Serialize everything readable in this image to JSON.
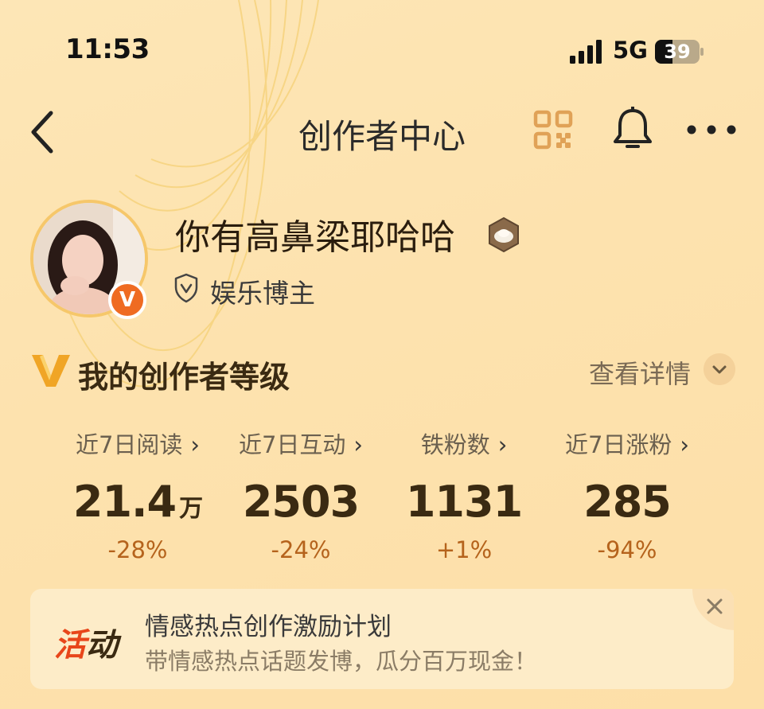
{
  "status_bar": {
    "time": "11:53",
    "network": "5G",
    "battery": "39"
  },
  "nav": {
    "title": "创作者中心",
    "icons": [
      "back-arrow-icon",
      "qr-code-icon",
      "bell-icon",
      "more-icon"
    ]
  },
  "profile": {
    "username": "你有高鼻梁耶哈哈",
    "badge": "V",
    "role": "娱乐博主"
  },
  "level_section": {
    "title": "我的创作者等级",
    "details_label": "查看详情"
  },
  "stats": [
    {
      "label": "近7日阅读",
      "value": "21.4",
      "unit": "万",
      "change": "-28%"
    },
    {
      "label": "近7日互动",
      "value": "2503",
      "unit": "",
      "change": "-24%"
    },
    {
      "label": "铁粉数",
      "value": "1131",
      "unit": "",
      "change": "+1%"
    },
    {
      "label": "近7日涨粉",
      "value": "285",
      "unit": "",
      "change": "-94%"
    }
  ],
  "activity": {
    "tag_part1": "活",
    "tag_part2": "动",
    "title": "情感热点创作激励计划",
    "subtitle": "带情感热点话题发博，瓜分百万现金！"
  },
  "colors": {
    "accent": "#ef6b22",
    "change": "#b5631c",
    "background": "#fde2ae",
    "activity_red": "#e8461a"
  }
}
